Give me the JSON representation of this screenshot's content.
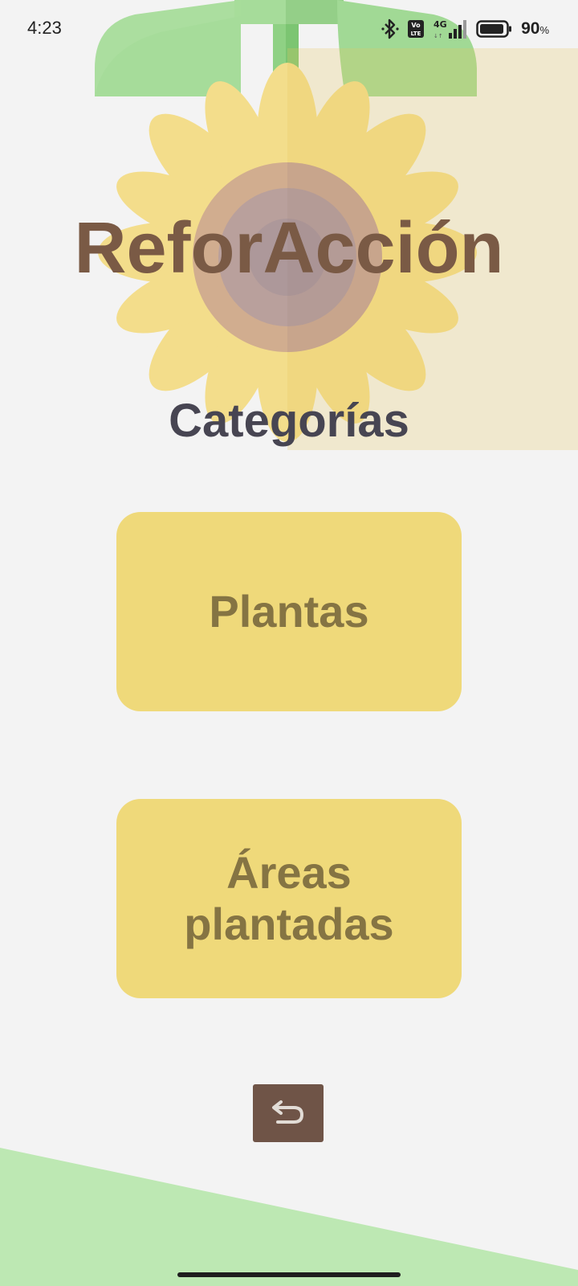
{
  "status_bar": {
    "time": "4:23",
    "battery_percent": "90",
    "battery_unit": "%",
    "icons": [
      "bluetooth-icon",
      "volte-icon",
      "signal-4g-icon",
      "battery-icon"
    ]
  },
  "app": {
    "title": "ReforAcción"
  },
  "main": {
    "section_title": "Categorías",
    "categories": [
      {
        "label": "Plantas"
      },
      {
        "label": "Áreas plantadas"
      }
    ],
    "back_button": {
      "icon": "undo-arrow-icon"
    }
  },
  "colors": {
    "background": "#f3f3f3",
    "title": "#7a5a45",
    "section_title": "#474552",
    "button_fill": "#efd97a",
    "button_text": "#857443",
    "back_button": "#6f5447",
    "leaf_green": "#a6dc9a",
    "petal_yellow": "#f3dd8b",
    "center_brown": "#c2a7a0",
    "bottom_green": "#bde8b3"
  }
}
